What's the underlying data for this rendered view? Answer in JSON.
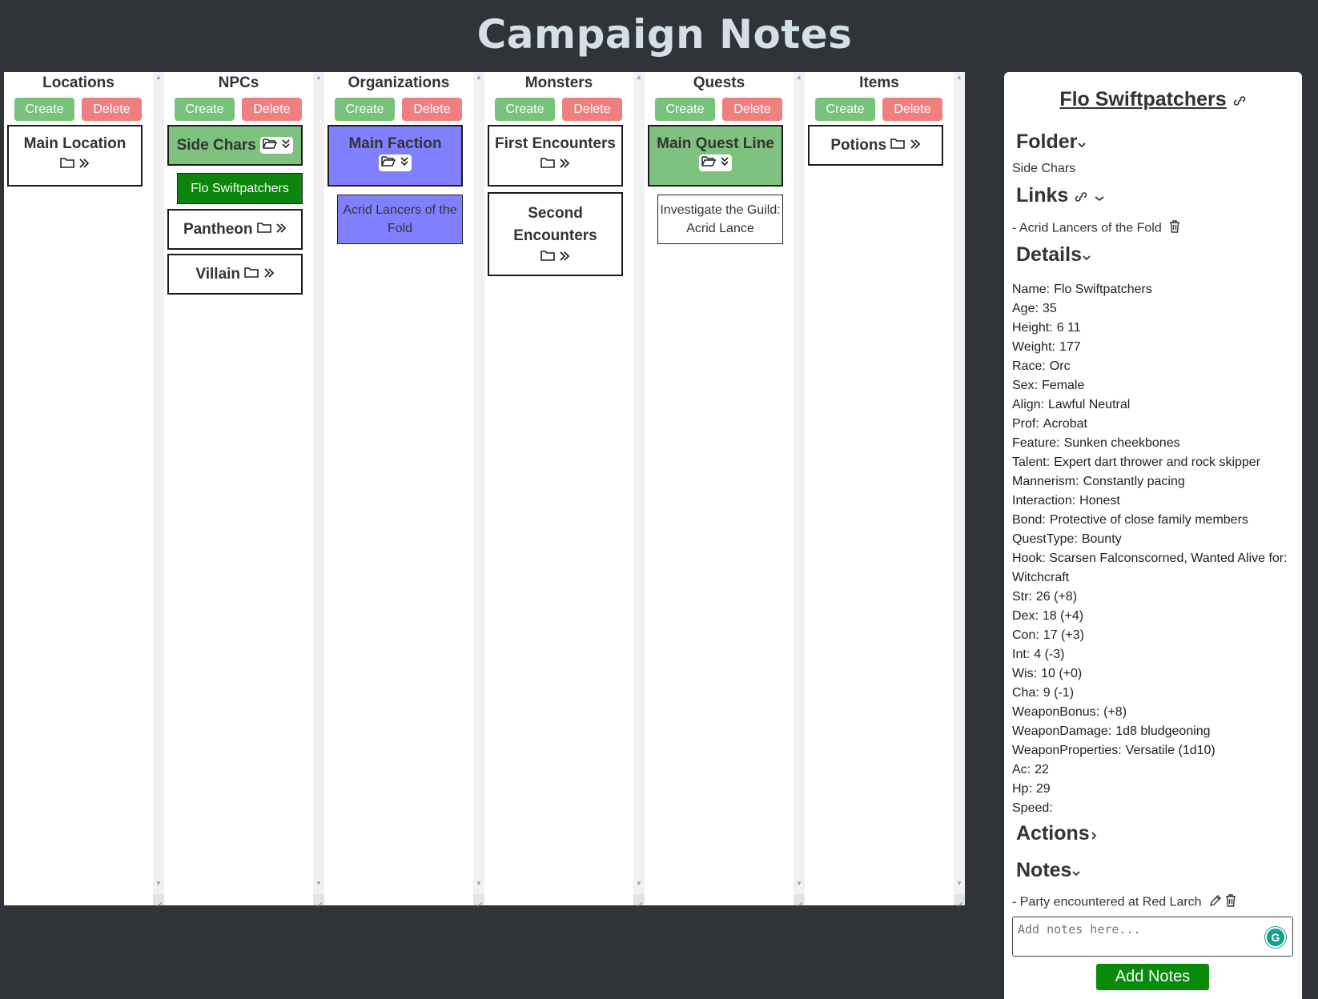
{
  "app": {
    "title": "Campaign Notes"
  },
  "columns": [
    {
      "header": "Locations",
      "create": "Create",
      "delete": "Delete",
      "cards": [
        {
          "label": "Main Location"
        }
      ]
    },
    {
      "header": "NPCs",
      "create": "Create",
      "delete": "Delete",
      "cards": [
        {
          "label": "Side Chars",
          "open": true,
          "child": "Flo Swiftpatchers"
        },
        {
          "label": "Pantheon"
        },
        {
          "label": "Villain"
        }
      ]
    },
    {
      "header": "Organizations",
      "create": "Create",
      "delete": "Delete",
      "cards": [
        {
          "label": "Main Faction",
          "open": true,
          "child": "Acrid Lancers of the Fold"
        }
      ]
    },
    {
      "header": "Monsters",
      "create": "Create",
      "delete": "Delete",
      "cards": [
        {
          "label": "First Encounters"
        },
        {
          "label": "Second Encounters"
        }
      ]
    },
    {
      "header": "Quests",
      "create": "Create",
      "delete": "Delete",
      "cards": [
        {
          "label": "Main Quest Line",
          "open": true,
          "child": "Investigate the Guild: Acrid Lance"
        }
      ]
    },
    {
      "header": "Items",
      "create": "Create",
      "delete": "Delete",
      "cards": [
        {
          "label": "Potions"
        }
      ]
    }
  ],
  "colors": {
    "open_npc": "#7fc17f",
    "selected_npc": "#0b850b",
    "open_org": "#8080ff",
    "open_quest": "#7fc17f",
    "create": "#78c27b",
    "delete": "#f08080"
  },
  "panel": {
    "name": "Flo Swiftpatchers",
    "folder_heading": "Folder",
    "folder_value": "Side Chars",
    "links_heading": "Links",
    "link_item": "- Acrid Lancers of the Fold",
    "details_heading": "Details",
    "details": [
      {
        "k": "Name:",
        "v": "Flo Swiftpatchers"
      },
      {
        "k": "Age:",
        "v": "35"
      },
      {
        "k": "Height:",
        "v": "6 11"
      },
      {
        "k": "Weight:",
        "v": "177"
      },
      {
        "k": "Race:",
        "v": "Orc"
      },
      {
        "k": "Sex:",
        "v": "Female"
      },
      {
        "k": "Align:",
        "v": "Lawful Neutral"
      },
      {
        "k": "Prof:",
        "v": "Acrobat"
      },
      {
        "k": "Feature:",
        "v": "Sunken cheekbones"
      },
      {
        "k": "Talent:",
        "v": "Expert dart thrower and rock skipper"
      },
      {
        "k": "Mannerism:",
        "v": "Constantly pacing"
      },
      {
        "k": "Interaction:",
        "v": "Honest"
      },
      {
        "k": "Bond:",
        "v": "Protective of close family members"
      },
      {
        "k": "QuestType:",
        "v": "Bounty"
      },
      {
        "k": "Hook:",
        "v": "Scarsen Falconscorned, Wanted Alive for: Witchcraft"
      },
      {
        "k": "Str:",
        "v": "26 (+8)"
      },
      {
        "k": "Dex:",
        "v": "18 (+4)"
      },
      {
        "k": "Con:",
        "v": "17 (+3)"
      },
      {
        "k": "Int:",
        "v": "4 (-3)"
      },
      {
        "k": "Wis:",
        "v": "10 (+0)"
      },
      {
        "k": "Cha:",
        "v": "9 (-1)"
      },
      {
        "k": "WeaponBonus:",
        "v": "(+8)"
      },
      {
        "k": "WeaponDamage:",
        "v": "1d8 bludgeoning"
      },
      {
        "k": "WeaponProperties:",
        "v": "Versatile (1d10)"
      },
      {
        "k": "Ac:",
        "v": "22"
      },
      {
        "k": "Hp:",
        "v": "29"
      },
      {
        "k": "Speed:",
        "v": ""
      }
    ],
    "actions_heading": "Actions",
    "notes_heading": "Notes",
    "note_item": "- Party encountered at Red Larch",
    "notes_placeholder": "Add notes here...",
    "add_notes": "Add Notes"
  }
}
